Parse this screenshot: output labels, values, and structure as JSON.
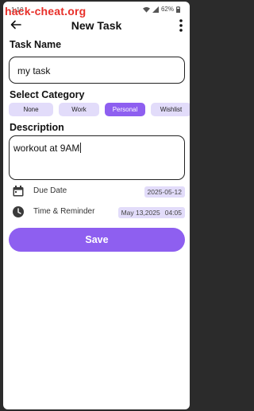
{
  "watermark": "hack-cheat.org",
  "status_bar": {
    "time": "1:10",
    "battery": "62%"
  },
  "header": {
    "title": "New Task",
    "back_icon": "arrow-left-icon",
    "more_icon": "more-vertical-icon"
  },
  "task_name": {
    "label": "Task Name",
    "value": "my task"
  },
  "category": {
    "label": "Select Category",
    "options": [
      "None",
      "Work",
      "Personal",
      "Wishlist"
    ],
    "selected": "Personal"
  },
  "description": {
    "label": "Description",
    "value": "workout at 9AM"
  },
  "due_date": {
    "icon": "calendar-icon",
    "label": "Due Date",
    "value": "2025-05-12"
  },
  "time_reminder": {
    "icon": "clock-icon",
    "label": "Time & Reminder",
    "date": "May 13,2025",
    "time": "04:05"
  },
  "save_label": "Save",
  "colors": {
    "accent": "#8e5ff0",
    "chip_bg": "#e2dcfa",
    "text": "#111111"
  }
}
